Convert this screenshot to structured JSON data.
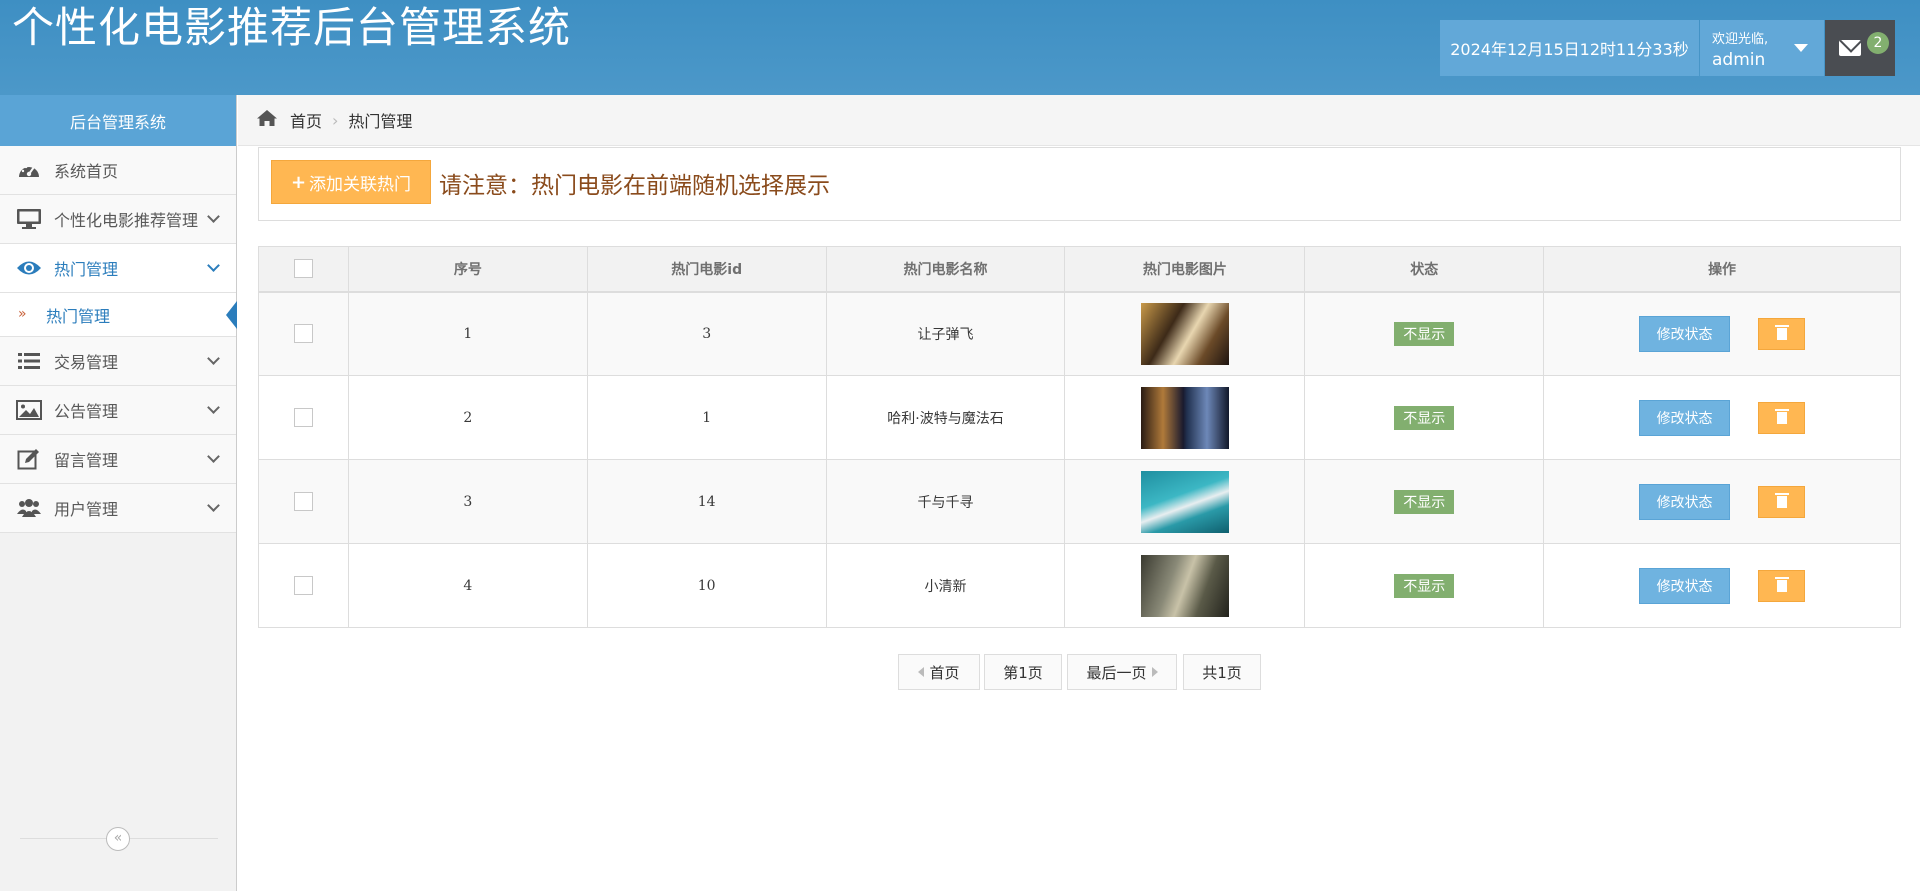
{
  "app": {
    "title": "个性化电影推荐后台管理系统"
  },
  "header": {
    "datetime": "2024年12月15日12时11分33秒",
    "welcome": "欢迎光临,",
    "username": "admin",
    "mail_count": "2"
  },
  "sidebar": {
    "title": "后台管理系统",
    "items": [
      {
        "label": "系统首页",
        "icon": "dashboard-icon"
      },
      {
        "label": "个性化电影推荐管理",
        "icon": "monitor-icon"
      },
      {
        "label": "热门管理",
        "icon": "eye-icon"
      },
      {
        "label": "交易管理",
        "icon": "list-icon"
      },
      {
        "label": "公告管理",
        "icon": "image-icon"
      },
      {
        "label": "留言管理",
        "icon": "edit-icon"
      },
      {
        "label": "用户管理",
        "icon": "users-icon"
      }
    ],
    "sub_item": "热门管理"
  },
  "breadcrumb": {
    "home": "首页",
    "current": "热门管理"
  },
  "toolbar": {
    "add_label": "添加关联热门",
    "notice": "请注意：热门电影在前端随机选择展示"
  },
  "table": {
    "headers": [
      "序号",
      "热门电影id",
      "热门电影名称",
      "热门电影图片",
      "状态",
      "操作"
    ],
    "rows": [
      {
        "seq": "1",
        "movie_id": "3",
        "name": "让子弹飞",
        "status": "不显示",
        "edit": "修改状态"
      },
      {
        "seq": "2",
        "movie_id": "1",
        "name": "哈利·波特与魔法石",
        "status": "不显示",
        "edit": "修改状态"
      },
      {
        "seq": "3",
        "movie_id": "14",
        "name": "千与千寻",
        "status": "不显示",
        "edit": "修改状态"
      },
      {
        "seq": "4",
        "movie_id": "10",
        "name": "小清新",
        "status": "不显示",
        "edit": "修改状态"
      }
    ]
  },
  "pagination": {
    "first": "首页",
    "current": "第1页",
    "last": "最后一页",
    "total": "共1页"
  },
  "colors": {
    "header_blue": "#4690c4",
    "accent_blue": "#6fb3e0",
    "warning_orange": "#ffb752",
    "success_green": "#82af6f",
    "notice_brown": "#8a4b1c"
  }
}
